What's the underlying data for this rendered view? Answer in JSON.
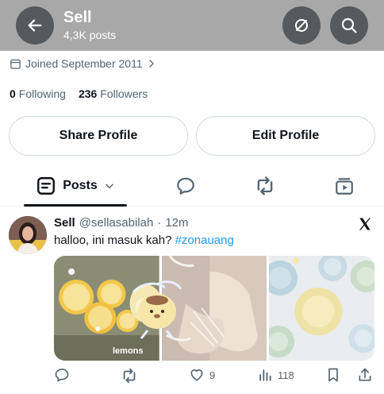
{
  "header": {
    "title": "Sell",
    "subtitle": "4,3K posts"
  },
  "profile": {
    "joined": "Joined September 2011",
    "following_count": "0",
    "following_label": "Following",
    "followers_count": "236",
    "followers_label": "Followers",
    "share_label": "Share Profile",
    "edit_label": "Edit Profile"
  },
  "tabs": {
    "posts_label": "Posts"
  },
  "post": {
    "name": "Sell",
    "handle": "@sellasabilah",
    "separator": "·",
    "time": "12m",
    "text": "halloo, ini masuk kah? ",
    "hashtag": "#zonauang",
    "image_caption": "lemons",
    "likes": "9",
    "views": "118"
  },
  "icons": {
    "back": "arrow-left-icon",
    "sync": "sync-off-icon",
    "search": "search-icon",
    "calendar": "calendar-icon",
    "chevron": "chevron-right-icon",
    "posts_tab": "posts-icon",
    "replies_tab": "reply-icon",
    "reposts_tab": "repost-icon",
    "media_tab": "media-icon",
    "x_logo": "x-logo-icon",
    "reply": "reply-icon",
    "retweet": "repost-icon",
    "like": "heart-icon",
    "views": "views-icon",
    "bookmark": "bookmark-icon",
    "share": "share-icon"
  },
  "colors": {
    "header_bg": "#a8a8a8",
    "button_bg": "#555a5e",
    "text": "#0f1419",
    "muted": "#536471",
    "link": "#1d9bf0",
    "border": "#cfd9de"
  }
}
